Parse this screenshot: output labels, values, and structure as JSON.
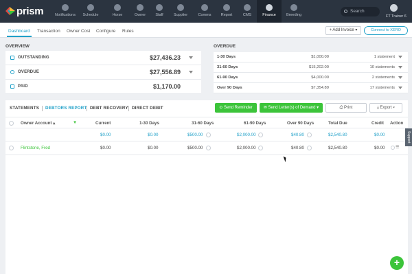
{
  "app": {
    "logo_text": "prism"
  },
  "nav": {
    "items": [
      {
        "label": "Notifications",
        "icon": "bell-icon"
      },
      {
        "label": "Schedule",
        "icon": "calendar-icon"
      },
      {
        "label": "Horse",
        "icon": "horse-icon"
      },
      {
        "label": "Owner",
        "icon": "person-icon"
      },
      {
        "label": "Staff",
        "icon": "people-icon"
      },
      {
        "label": "Supplier",
        "icon": "truck-icon"
      },
      {
        "label": "Comms",
        "icon": "chat-icon"
      },
      {
        "label": "Report",
        "icon": "chart-icon"
      },
      {
        "label": "CMS",
        "icon": "gear-icon"
      },
      {
        "label": "Finance",
        "icon": "money-icon",
        "active": true
      },
      {
        "label": "Breeding",
        "icon": "horse-head-icon"
      }
    ],
    "search_placeholder": "Search",
    "user_name": "FT Trainer 6"
  },
  "subnav": {
    "tabs": [
      "Dashboard",
      "Transaction",
      "Owner Cost",
      "Configure",
      "Rules"
    ],
    "active": "Dashboard",
    "add_invoice_label": "+ Add Invoice ▾",
    "connect_label": "Connect to XERO"
  },
  "overview": {
    "title": "OVERVIEW",
    "rows": [
      {
        "label": "OUTSTANDING",
        "amount": "$27,436.23",
        "icon": "calendar-icon"
      },
      {
        "label": "OVERDUE",
        "amount": "$27,556.89",
        "icon": "clock-icon"
      },
      {
        "label": "PAID",
        "amount": "$1,170.00",
        "icon": "cash-icon"
      }
    ]
  },
  "overdue": {
    "title": "OVERDUE",
    "rows": [
      {
        "label": "1-30 Days",
        "amount": "$1,000.00",
        "statements": "1 statement"
      },
      {
        "label": "31-60 Days",
        "amount": "$15,202.00",
        "statements": "10 statements"
      },
      {
        "label": "61-90 Days",
        "amount": "$4,000.00",
        "statements": "2 statements"
      },
      {
        "label": "Over 90 Days",
        "amount": "$7,354.89",
        "statements": "17 statements"
      }
    ]
  },
  "report_tabs": {
    "statements": "STATEMENTS",
    "debtors_report": "DEBTORS REPORT",
    "debt_recovery": "DEBT RECOVERY",
    "direct_debit": "DIRECT DEBIT"
  },
  "actions": {
    "send_reminder": "⊙ Send Reminder",
    "send_letters": "✉ Send Letter(s) of Demand ▾",
    "print": "⎙ Print",
    "export": "⤓ Export ▾"
  },
  "table": {
    "headers": {
      "owner": "Owner Account ▴",
      "current": "Current",
      "d1_30": "1-30 Days",
      "d31_60": "31-60 Days",
      "d61_90": "61-90 Days",
      "over90": "Over 90 Days",
      "total": "Total Due",
      "credit": "Credit",
      "action": "Action"
    },
    "totals": {
      "current": "$0.00",
      "d1_30": "$0.00",
      "d31_60": "$500.00",
      "d61_90": "$2,000.00",
      "over90": "$40.80",
      "total": "$2,540.80",
      "credit": "$0.00"
    },
    "rows": [
      {
        "owner": "Flintstone, Fred",
        "current": "$0.00",
        "d1_30": "$0.00",
        "d31_60": "$500.00",
        "d61_90": "$2,000.00",
        "over90": "$40.80",
        "total": "$2,540.80",
        "credit": "$0.00"
      }
    ]
  },
  "support_label": "Support",
  "fab_label": "+",
  "colors": {
    "accent": "#1fa0c8",
    "green": "#3cc43a",
    "nav_bg": "#2b3440"
  }
}
